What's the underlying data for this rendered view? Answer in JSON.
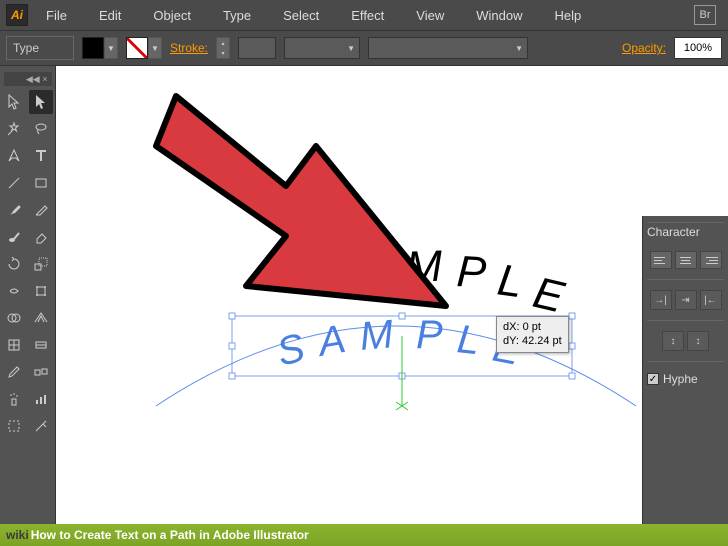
{
  "app": {
    "icon_text": "Ai",
    "br_icon": "Br"
  },
  "menu": [
    "File",
    "Edit",
    "Object",
    "Type",
    "Select",
    "Effect",
    "View",
    "Window",
    "Help"
  ],
  "options": {
    "type_label": "Type",
    "stroke_label": "Stroke:",
    "opacity_label": "Opacity:",
    "opacity_value": "100%"
  },
  "canvas": {
    "text_black": "SAMPLE",
    "text_blue": "SAMPLE",
    "tooltip_dx": "dX: 0 pt",
    "tooltip_dy": "dY: 42.24 pt"
  },
  "right_panel": {
    "character_tab": "Character",
    "hyphenate_label": "Hyphe",
    "hyphenate_checked": "✓"
  },
  "footer": {
    "prefix": "wiki",
    "title": "How to Create Text on a Path in Adobe Illustrator"
  }
}
